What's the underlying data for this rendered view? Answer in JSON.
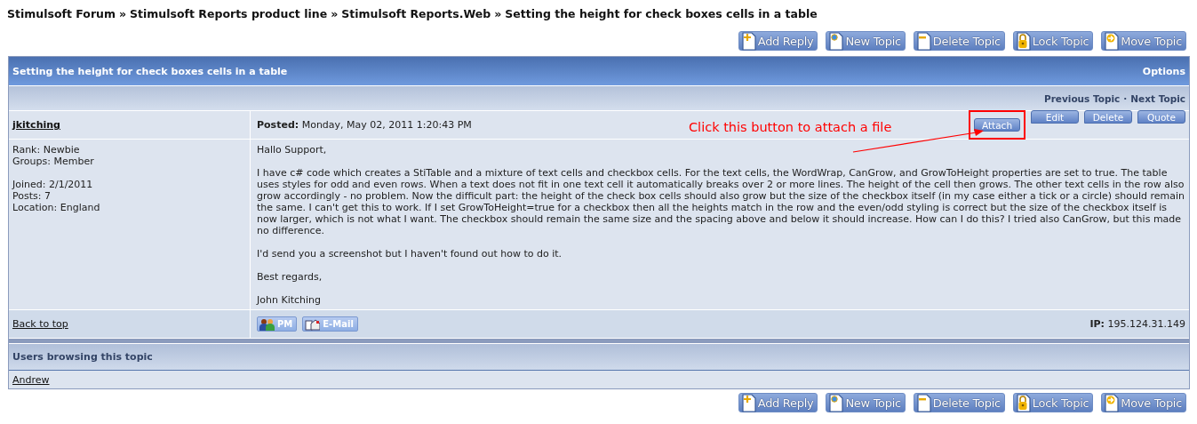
{
  "breadcrumb": [
    {
      "label": "Stimulsoft Forum",
      "separator": "»"
    },
    {
      "label": "Stimulsoft Reports product line",
      "separator": "»"
    },
    {
      "label": "Stimulsoft Reports.Web",
      "separator": "»"
    },
    {
      "label": "Setting the height for check boxes cells in a table"
    }
  ],
  "top_buttons": [
    {
      "kind": "add",
      "label": "Add Reply"
    },
    {
      "kind": "new",
      "label": "New Topic"
    },
    {
      "kind": "delete",
      "label": "Delete Topic"
    },
    {
      "kind": "lock",
      "label": "Lock Topic"
    },
    {
      "kind": "move",
      "label": "Move Topic"
    }
  ],
  "topic": {
    "title": "Setting the height for check boxes cells in a table",
    "options": "Options"
  },
  "nav": {
    "previous": "Previous Topic",
    "separator": "·",
    "next": "Next Topic"
  },
  "post": {
    "author": "jkitching",
    "posted_label": "Posted:",
    "posted_date": "Monday, May 02, 2011 1:20:43 PM",
    "actions": [
      {
        "label": "Attach",
        "highlighted": true
      },
      {
        "label": "Edit",
        "highlighted": false
      },
      {
        "label": "Delete",
        "highlighted": false
      },
      {
        "label": "Quote",
        "highlighted": false
      }
    ],
    "profile": [
      [
        "Rank: Newbie",
        "Groups: Member"
      ],
      [
        "Joined: 2/1/2011",
        "Posts: 7",
        "Location: England"
      ]
    ],
    "body": [
      "Hallo Support,",
      "I have c# code which creates a StiTable and a mixture of text cells and checkbox cells. For the text cells, the WordWrap, CanGrow, and GrowToHeight properties are set to true. The table uses styles for odd and even rows. When a text does not fit in one text cell it automatically breaks over 2 or more lines. The height of the cell then grows. The other text cells in the row also grow accordingly - no problem. Now the difficult part: the height of the check box cells should also grow but the size of the checkbox itself (in my case either a tick or a circle) should remain the same. I can't get this to work. If I set GrowToHeight=true for a checkbox then all the heights match in the row and the even/odd styling is correct but the size of the checkbox itself is now larger, which is not what I want. The checkbox should remain the same size and the spacing above and below it should increase. How can I do this? I tried also CanGrow, but this made no difference.",
      "I'd send you a screenshot but I haven't found out how to do it.",
      "Best regards,",
      "John Kitching"
    ],
    "back_to_top": "Back to top",
    "contact_buttons": [
      {
        "kind": "pm",
        "label": "PM"
      },
      {
        "kind": "email",
        "label": "E-Mail"
      }
    ],
    "ip_label": "IP:",
    "ip": "195.124.31.149"
  },
  "annotation": {
    "text": "Click this button to attach a file"
  },
  "users_browsing": {
    "title": "Users browsing this topic",
    "users": [
      "Andrew"
    ]
  },
  "bottom_buttons": [
    {
      "kind": "add",
      "label": "Add Reply"
    },
    {
      "kind": "new",
      "label": "New Topic"
    },
    {
      "kind": "delete",
      "label": "Delete Topic"
    },
    {
      "kind": "lock",
      "label": "Lock Topic"
    },
    {
      "kind": "move",
      "label": "Move Topic"
    }
  ]
}
